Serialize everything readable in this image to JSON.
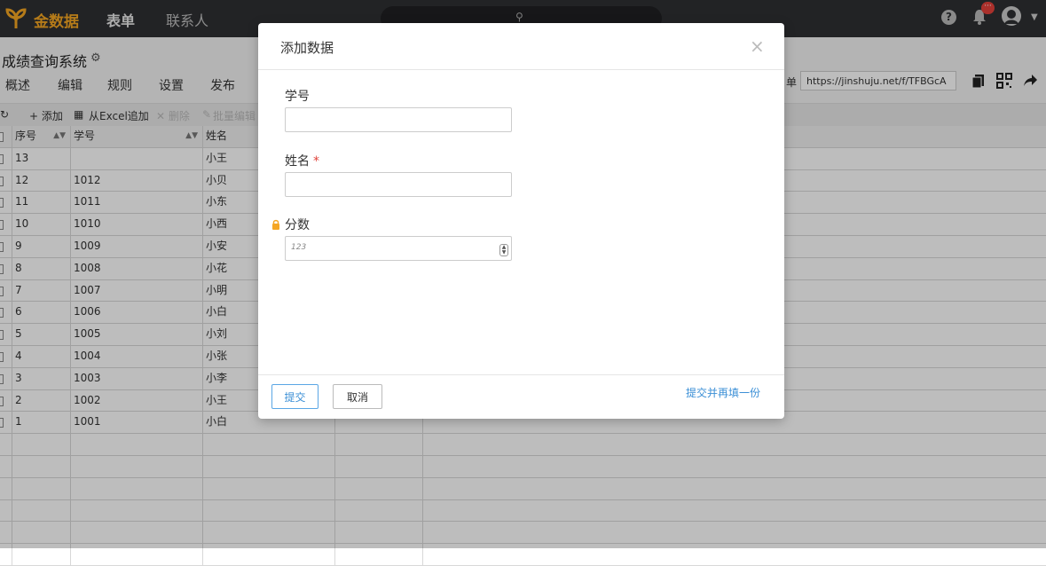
{
  "topbar": {
    "brand": "金数据",
    "nav": [
      "表单",
      "联系人"
    ],
    "help_glyph": "?",
    "notification_badge": "···",
    "icons": [
      "logo-icon",
      "search-icon",
      "help-icon",
      "bell-icon",
      "avatar-icon",
      "chevron-down-icon"
    ]
  },
  "page": {
    "title": "成绩查询系统",
    "subnav": [
      "概述",
      "编辑",
      "规则",
      "设置",
      "发布"
    ],
    "share_label": "单",
    "share_url": "https://jinshuju.net/f/TFBGcA"
  },
  "toolbar": {
    "refresh_glyph": "↻",
    "add": "+ 添加",
    "excel_add": "从Excel追加",
    "delete": "✕ 删除",
    "batch_edit": "批量编辑"
  },
  "table": {
    "headers": [
      "序号",
      "学号",
      "姓名"
    ],
    "rows": [
      [
        "13",
        "",
        "小王"
      ],
      [
        "12",
        "1012",
        "小贝"
      ],
      [
        "11",
        "1011",
        "小东"
      ],
      [
        "10",
        "1010",
        "小西"
      ],
      [
        "9",
        "1009",
        "小安"
      ],
      [
        "8",
        "1008",
        "小花"
      ],
      [
        "7",
        "1007",
        "小明"
      ],
      [
        "6",
        "1006",
        "小白"
      ],
      [
        "5",
        "1005",
        "小刘"
      ],
      [
        "4",
        "1004",
        "小张"
      ],
      [
        "3",
        "1003",
        "小李"
      ],
      [
        "2",
        "1002",
        "小王"
      ],
      [
        "1",
        "1001",
        "小白"
      ]
    ],
    "empty_rows": 6
  },
  "modal": {
    "title": "添加数据",
    "close_glyph": "×",
    "fields": [
      {
        "label": "学号",
        "required": false,
        "value": ""
      },
      {
        "label": "姓名",
        "required": true,
        "value": ""
      },
      {
        "label": "分数",
        "required": false,
        "locked": true,
        "value": "",
        "placeholder": "123"
      }
    ],
    "required_mark": "*",
    "submit": "提交",
    "cancel": "取消",
    "submit_again": "提交并再填一份"
  },
  "colors": {
    "brand": "#f5a623",
    "topbar": "#2f3033",
    "link": "#3b8fd6",
    "required": "#e0443b"
  }
}
